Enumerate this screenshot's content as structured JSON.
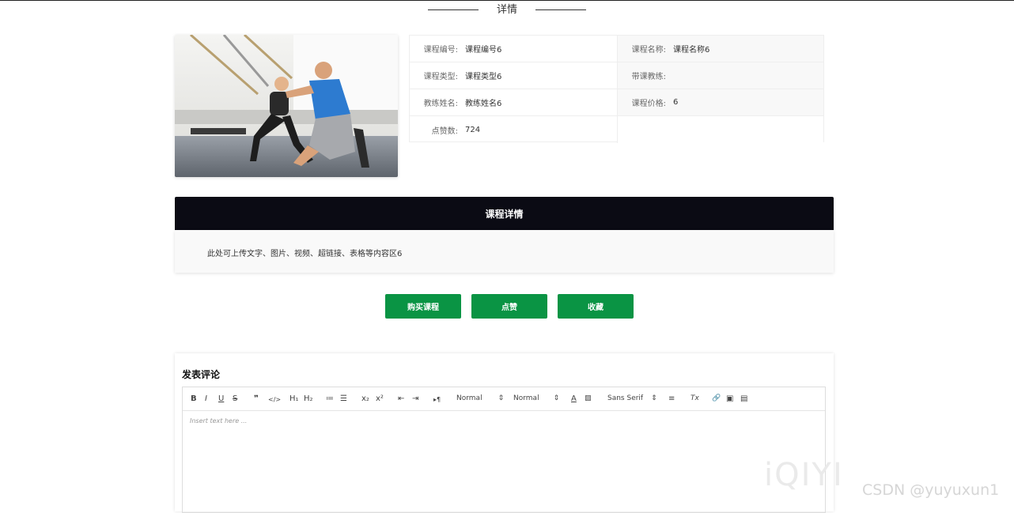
{
  "page": {
    "title": "详情"
  },
  "course": {
    "fields": [
      {
        "label": "课程编号:",
        "value": "课程编号6"
      },
      {
        "label": "课程名称:",
        "value": "课程名称6"
      },
      {
        "label": "课程类型:",
        "value": "课程类型6"
      },
      {
        "label": "带课教练:",
        "value": ""
      },
      {
        "label": "教练姓名:",
        "value": "教练姓名6"
      },
      {
        "label": "课程价格:",
        "value": "6"
      },
      {
        "label": "点赞数:",
        "value": "724"
      }
    ]
  },
  "detail": {
    "header": "课程详情",
    "text": "此处可上传文字、图片、视频、超链接、表格等内容区6"
  },
  "actions": {
    "buy": "购买课程",
    "like": "点赞",
    "favorite": "收藏"
  },
  "comment": {
    "title": "发表评论",
    "placeholder": "Insert text here ...",
    "toolbar": {
      "bold": "B",
      "italic": "I",
      "underline": "U",
      "strike": "S",
      "quote": "❞",
      "code": "</>",
      "h1": "H₁",
      "h2": "H₂",
      "ordered_list": "≔",
      "bullet_list": "☰",
      "subscript": "x₂",
      "superscript": "x²",
      "outdent": "⇤",
      "indent": "⇥",
      "direction": "▸¶",
      "size_value": "Normal",
      "header_value": "Normal",
      "color": "A",
      "background": "▨",
      "font_value": "Sans Serif",
      "align": "≡",
      "clean": "Tx",
      "link": "🔗",
      "image": "▣",
      "video": "▤"
    }
  },
  "watermarks": {
    "iqiyi": "iQIYI",
    "csdn": "CSDN @yuyuxun1"
  },
  "colors": {
    "accent": "#0a9444",
    "header_bg": "#0b0b14"
  }
}
